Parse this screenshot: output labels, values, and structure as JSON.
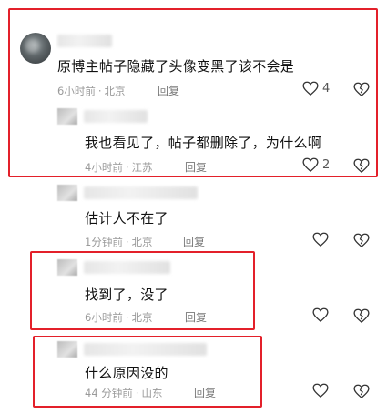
{
  "comments": [
    {
      "text": "原博主帖子隐藏了头像变黑了该不会是",
      "time": "6小时前",
      "location": "北京",
      "reply": "回复",
      "likes": "4"
    },
    {
      "text": "我也看见了，帖子都删除了，为什么啊",
      "time": "4小时前",
      "location": "江苏",
      "reply": "回复",
      "likes": "2"
    },
    {
      "text": "估计人不在了",
      "time": "1分钟前",
      "location": "北京",
      "reply": "回复",
      "likes": ""
    },
    {
      "text": "找到了，没了",
      "time": "6小时前",
      "location": "北京",
      "reply": "回复",
      "likes": ""
    },
    {
      "text": "什么原因没的",
      "time": "44 分钟前",
      "location": "山东",
      "reply": "回复",
      "likes": ""
    }
  ],
  "meta_separator": "·",
  "colors": {
    "highlight_box": "#e3202a",
    "meta_text": "#9a9a9a"
  }
}
